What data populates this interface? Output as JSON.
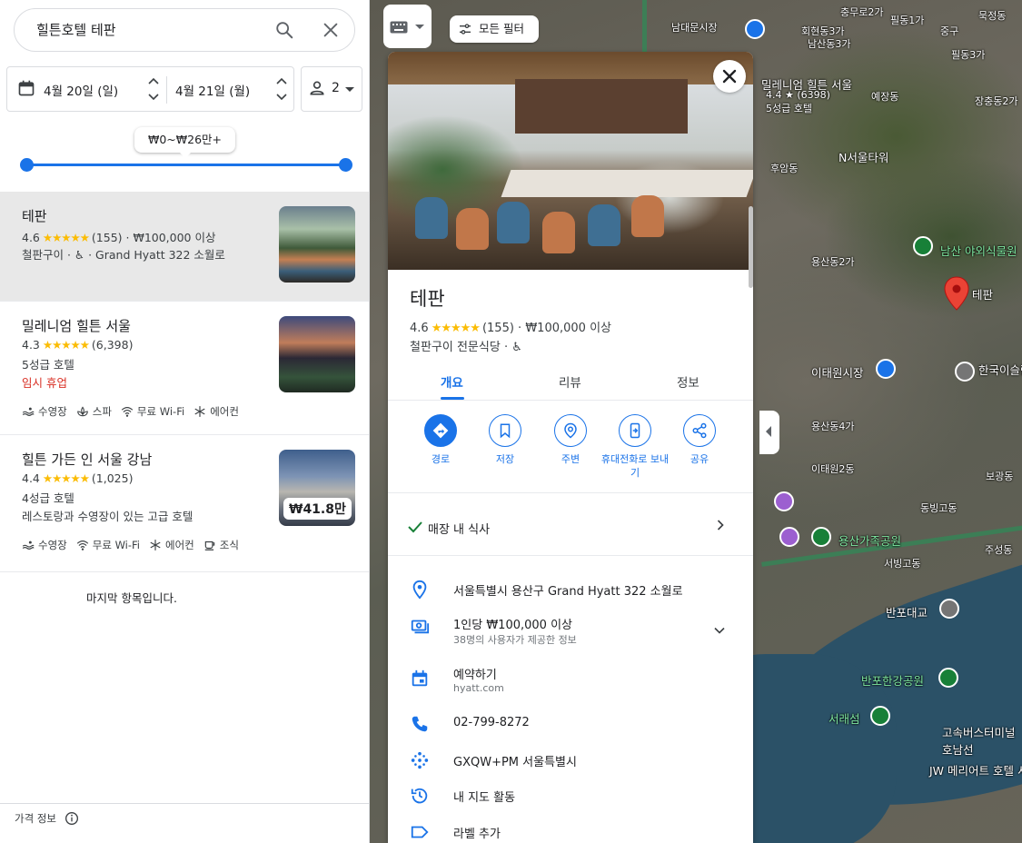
{
  "search": {
    "value": "힐튼호텔 테판"
  },
  "dates": {
    "checkin": "4월 20일 (일)",
    "checkout": "4월 21일 (월)",
    "guests": "2"
  },
  "price_filter": {
    "label": "₩0~₩26만+"
  },
  "results": [
    {
      "name": "테판",
      "rating": "4.6",
      "stars": "★★★★★",
      "details": "(155) · ₩100,000 이상",
      "line1": "철판구이 · ♿ · Grand Hyatt 322 소월로",
      "line2": "",
      "amenities": []
    },
    {
      "name": "밀레니엄 힐튼 서울",
      "rating": "4.3",
      "stars": "★★★★★",
      "details": "(6,398)",
      "line1": "5성급 호텔",
      "line2": "임시 휴업",
      "amenities": [
        "수영장",
        "스파",
        "무료 Wi-Fi",
        "에어컨"
      ]
    },
    {
      "name": "힐튼 가든 인 서울 강남",
      "rating": "4.4",
      "stars": "★★★★★",
      "details": "(1,025)",
      "line1": "4성급 호텔",
      "line2": "레스토랑과 수영장이 있는 고급 호텔",
      "amenities": [
        "수영장",
        "무료 Wi-Fi",
        "에어컨",
        "조식"
      ],
      "price_badge": "₩41.8만"
    }
  ],
  "end_of_list": "마지막 항목입니다.",
  "price_info": "가격 정보",
  "map": {
    "filter_button": "모든 필터",
    "labels": [
      "남대문시장",
      "회현동3가",
      "남산동3가",
      "충무로2가",
      "필동1가",
      "묵정동",
      "필동3가",
      "장충동2가",
      "밀레니엄 힐튼 서울",
      "4.4 ★ (6398)",
      "5성급 호텔",
      "예장동",
      "N서울타워",
      "후암동",
      "남산 야외식물원",
      "테판",
      "용산동2가",
      "이태원시장",
      "한국이슬람교 서울중앙성원",
      "용산동4가",
      "보광동",
      "용산가족공원",
      "서빙고동",
      "반포대교",
      "반포한강공원",
      "서래섬",
      "고속버스터미널 호남선",
      "JW 메리어트 호텔 서울",
      "주성동",
      "동빙고동",
      "이태원2동",
      "중구"
    ],
    "pins_color": "#ea4335"
  },
  "detail": {
    "title": "테판",
    "rating": "4.6",
    "stars": "★★★★★",
    "details": "(155) · ₩100,000 이상",
    "category": "철판구이 전문식당 · ♿",
    "tabs": [
      "개요",
      "리뷰",
      "정보"
    ],
    "actions": [
      "경로",
      "저장",
      "주변",
      "휴대전화로 보내기",
      "공유"
    ],
    "dine_in": "매장 내 식사",
    "address": "서울특별시 용산구 Grand Hyatt 322 소월로",
    "price": "1인당 ₩100,000 이상",
    "price_sub": "38명의 사용자가 제공한 정보",
    "reserve": "예약하기",
    "reserve_sub": "hyatt.com",
    "phone": "02-799-8272",
    "plus_code": "GXQW+PM 서울특별시",
    "activity": "내 지도 활동",
    "add_label": "라벨 추가"
  },
  "colors": {
    "accent": "#1a73e8",
    "star": "#fbbc04",
    "closed": "#d93025",
    "selected_bg": "#e8e8e8"
  }
}
